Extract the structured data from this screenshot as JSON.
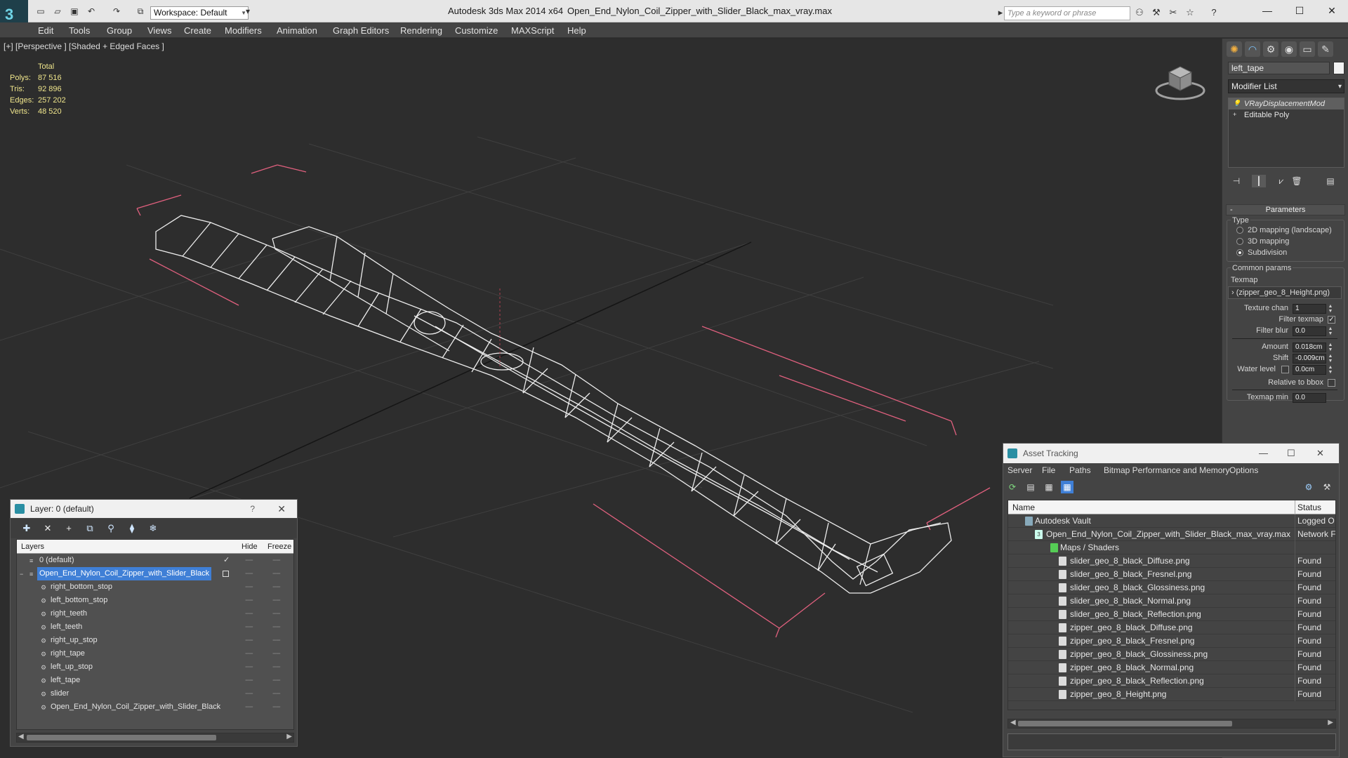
{
  "titlebar": {
    "workspace": "Workspace: Default",
    "app_title": "Autodesk 3ds Max  2014 x64",
    "file_title": "Open_End_Nylon_Coil_Zipper_with_Slider_Black_max_vray.max",
    "search_placeholder": "Type a keyword or phrase",
    "logo_glyph": "3",
    "min_glyph": "—",
    "max_glyph": "☐",
    "close_glyph": "✕"
  },
  "menu": [
    "Edit",
    "Tools",
    "Group",
    "Views",
    "Create",
    "Modifiers",
    "Animation",
    "Graph Editors",
    "Rendering",
    "Customize",
    "MAXScript",
    "Help"
  ],
  "viewport": {
    "label": "[+] [Perspective ] [Shaded + Edged Faces ]",
    "stats_header": "Total",
    "stats": [
      {
        "label": "Polys:",
        "value": "87 516"
      },
      {
        "label": "Tris:",
        "value": "92 896"
      },
      {
        "label": "Edges:",
        "value": "257 202"
      },
      {
        "label": "Verts:",
        "value": "48 520"
      }
    ],
    "stats_color": "#f0e68c",
    "bbox_color": "#e0607e"
  },
  "command_panel": {
    "object_name": "left_tape",
    "modifier_list": "Modifier List",
    "stack": [
      {
        "label": "VRayDisplacementMod",
        "selected": true,
        "icon": "💡"
      },
      {
        "label": "Editable Poly",
        "selected": false,
        "icon": "+"
      }
    ],
    "rollout_title": "Parameters",
    "type_group": "Type",
    "radios": [
      {
        "label": "2D mapping (landscape)",
        "on": false
      },
      {
        "label": "3D mapping",
        "on": false
      },
      {
        "label": "Subdivision",
        "on": true
      }
    ],
    "common_group": "Common params",
    "texmap_label": "Texmap",
    "texmap_value": "› (zipper_geo_8_Height.png)",
    "texture_chan_label": "Texture chan",
    "texture_chan_value": "1",
    "filter_texmap_label": "Filter texmap",
    "filter_texmap_checked": true,
    "filter_blur_label": "Filter blur",
    "filter_blur_value": "0.0",
    "amount_label": "Amount",
    "amount_value": "0.018cm",
    "shift_label": "Shift",
    "shift_value": "-0.009cm",
    "water_level_label": "Water level",
    "water_level_value": "0.0cm",
    "relative_bbox_label": "Relative to bbox",
    "texmap_min_label": "Texmap min",
    "texmap_min_value": "0.0"
  },
  "layer_window": {
    "title": "Layer: 0 (default)",
    "help": "?",
    "close": "✕",
    "columns": {
      "layers": "Layers",
      "hide": "Hide",
      "freeze": "Freeze"
    },
    "rows": [
      {
        "name": "0 (default)",
        "level": 0,
        "selected": false,
        "current": true
      },
      {
        "name": "Open_End_Nylon_Coil_Zipper_with_Slider_Black",
        "level": 0,
        "selected": true,
        "current": false
      },
      {
        "name": "right_bottom_stop",
        "level": 1,
        "selected": false,
        "current": false
      },
      {
        "name": "left_bottom_stop",
        "level": 1,
        "selected": false,
        "current": false
      },
      {
        "name": "right_teeth",
        "level": 1,
        "selected": false,
        "current": false
      },
      {
        "name": "left_teeth",
        "level": 1,
        "selected": false,
        "current": false
      },
      {
        "name": "right_up_stop",
        "level": 1,
        "selected": false,
        "current": false
      },
      {
        "name": "right_tape",
        "level": 1,
        "selected": false,
        "current": false
      },
      {
        "name": "left_up_stop",
        "level": 1,
        "selected": false,
        "current": false
      },
      {
        "name": "left_tape",
        "level": 1,
        "selected": false,
        "current": false
      },
      {
        "name": "slider",
        "level": 1,
        "selected": false,
        "current": false
      },
      {
        "name": "Open_End_Nylon_Coil_Zipper_with_Slider_Black",
        "level": 1,
        "selected": false,
        "current": false
      }
    ],
    "dash": "----",
    "check": "✓"
  },
  "asset_window": {
    "title": "Asset Tracking",
    "menu": [
      "Server",
      "File",
      "Paths",
      "Bitmap Performance and Memory",
      "Options"
    ],
    "columns": {
      "name": "Name",
      "status": "Status"
    },
    "rows": [
      {
        "name": "Autodesk Vault",
        "status": "Logged O",
        "level": 1
      },
      {
        "name": "Open_End_Nylon_Coil_Zipper_with_Slider_Black_max_vray.max",
        "status": "Network F",
        "level": 2
      },
      {
        "name": "Maps / Shaders",
        "status": "",
        "level": 3
      },
      {
        "name": "slider_geo_8_black_Diffuse.png",
        "status": "Found",
        "level": 4
      },
      {
        "name": "slider_geo_8_black_Fresnel.png",
        "status": "Found",
        "level": 4
      },
      {
        "name": "slider_geo_8_black_Glossiness.png",
        "status": "Found",
        "level": 4
      },
      {
        "name": "slider_geo_8_black_Normal.png",
        "status": "Found",
        "level": 4
      },
      {
        "name": "slider_geo_8_black_Reflection.png",
        "status": "Found",
        "level": 4
      },
      {
        "name": "zipper_geo_8_black_Diffuse.png",
        "status": "Found",
        "level": 4
      },
      {
        "name": "zipper_geo_8_black_Fresnel.png",
        "status": "Found",
        "level": 4
      },
      {
        "name": "zipper_geo_8_black_Glossiness.png",
        "status": "Found",
        "level": 4
      },
      {
        "name": "zipper_geo_8_black_Normal.png",
        "status": "Found",
        "level": 4
      },
      {
        "name": "zipper_geo_8_black_Reflection.png",
        "status": "Found",
        "level": 4
      },
      {
        "name": "zipper_geo_8_Height.png",
        "status": "Found",
        "level": 4
      }
    ]
  }
}
